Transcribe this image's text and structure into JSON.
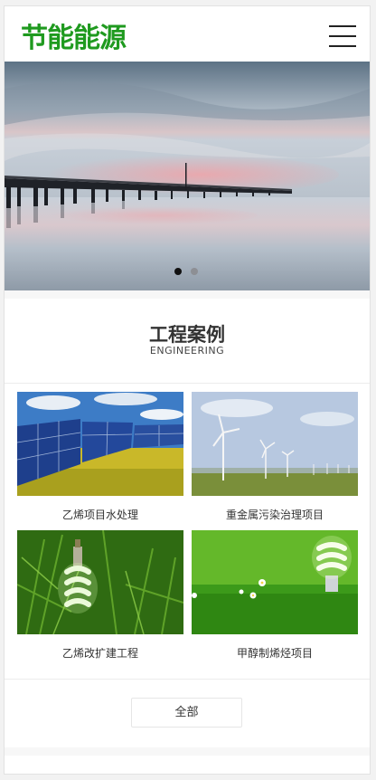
{
  "header": {
    "logo_text": "节能能源",
    "menu_icon": "hamburger-menu-icon"
  },
  "banner": {
    "image": "pier-over-calm-sea-at-dusk",
    "slide_count": 2,
    "active_slide": 1
  },
  "engineering": {
    "title": "工程案例",
    "subtitle": "ENGINEERING",
    "cases": [
      {
        "caption": "乙烯项目水处理",
        "image": "solar-panels-in-field"
      },
      {
        "caption": "重金属污染治理项目",
        "image": "wind-turbines-on-grassland"
      },
      {
        "caption": "乙烯改扩建工程",
        "image": "energy-saving-bulb-on-grass"
      },
      {
        "caption": "甲醇制烯烃项目",
        "image": "energy-saving-bulb-with-daisies"
      }
    ],
    "all_button": "全部"
  },
  "colors": {
    "brand_green": "#1f9a1f",
    "background": "#f2f2f2"
  }
}
